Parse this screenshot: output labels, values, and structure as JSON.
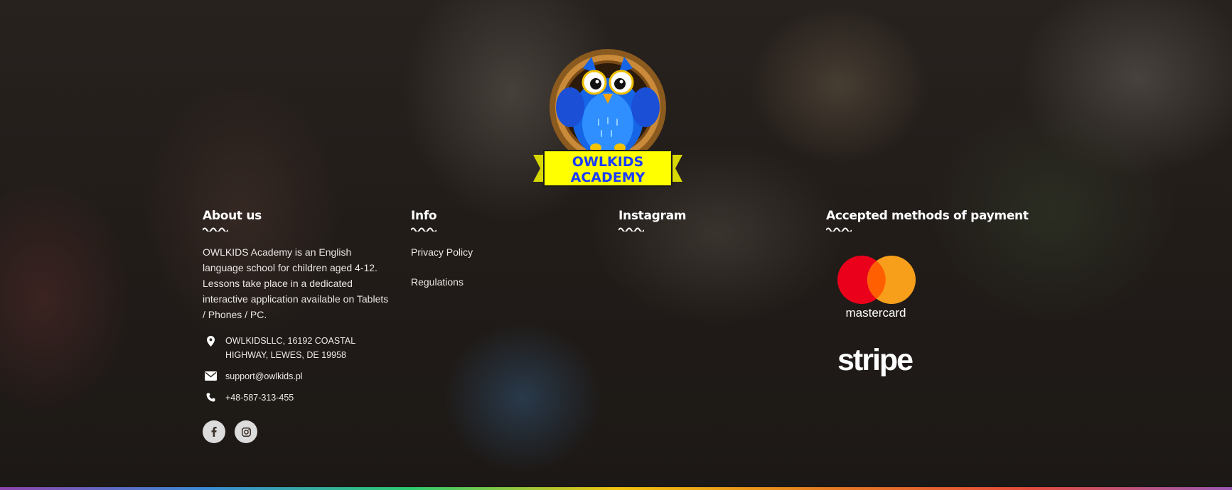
{
  "brand": {
    "logo_line1": "OWLKIDS",
    "logo_line2": "ACADEMY"
  },
  "about": {
    "title": "About us",
    "text": "OWLKIDS Academy is an English language school for children aged 4-12. Lessons take place in a dedicated interactive application available on Tablets / Phones / PC.",
    "address": "OWLKIDSLLC, 16192 COASTAL HIGHWAY, LEWES, DE 19958",
    "email": "support@owlkids.pl",
    "phone": "+48-587-313-455",
    "social_icons": [
      "facebook-icon",
      "instagram-icon"
    ]
  },
  "info": {
    "title": "Info",
    "links": [
      "Privacy Policy",
      "Regulations"
    ]
  },
  "instagram": {
    "title": "Instagram"
  },
  "payment": {
    "title": "Accepted methods of payment",
    "methods": [
      "mastercard",
      "stripe"
    ]
  },
  "colors": {
    "mastercard_red": "#eb001b",
    "mastercard_orange": "#f79e1b",
    "logo_yellow": "#ffff00",
    "logo_blue": "#1a3cff",
    "owl_blue": "#1e90ff"
  }
}
